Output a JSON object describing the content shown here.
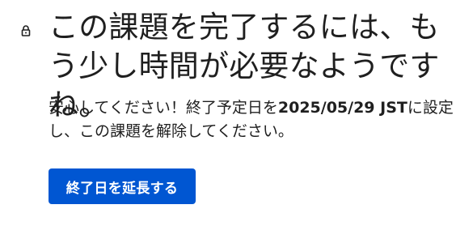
{
  "icon": "lock-icon",
  "colors": {
    "text": "#1f1f1f",
    "button_bg": "#0056d2",
    "button_text": "#ffffff"
  },
  "heading": "この課題を完了するには、もう少し時間が必要なようですね。",
  "message": {
    "before": "安心してください！終了予定日を",
    "deadline": "2025/05/29 JST",
    "after": "に設定し、この課題を解除してください。"
  },
  "button": {
    "label": "終了日を延長する"
  }
}
